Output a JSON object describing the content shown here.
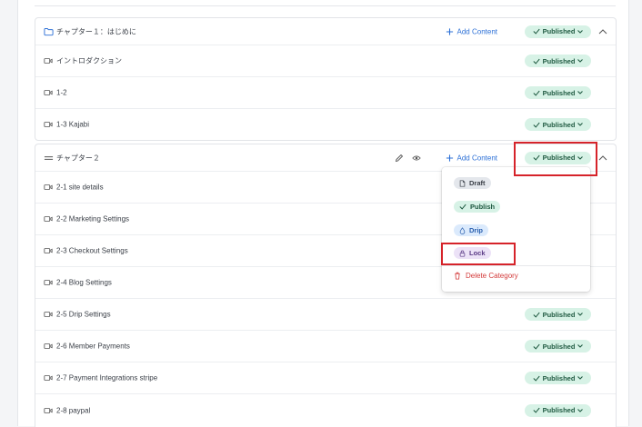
{
  "chapters": [
    {
      "title": "チャプター１：はじめに",
      "add_label": "Add Content",
      "status": "Published",
      "lessons": [
        {
          "title": "イントロダクション",
          "status": "Published"
        },
        {
          "title": "1-2",
          "status": "Published"
        },
        {
          "title": "1-3 Kajabi",
          "status": "Published"
        }
      ]
    },
    {
      "title": "チャプター２",
      "add_label": "Add Content",
      "status": "Published",
      "lessons": [
        {
          "title": "2-1 site details",
          "status": ""
        },
        {
          "title": "2-2 Marketing Settings",
          "status": ""
        },
        {
          "title": "2-3 Checkout Settings",
          "status": ""
        },
        {
          "title": "2-4 Blog Settings",
          "status": ""
        },
        {
          "title": "2-5 Drip Settings",
          "status": "Published"
        },
        {
          "title": "2-6 Member Payments",
          "status": "Published"
        },
        {
          "title": "2-7 Payment Integrations stripe",
          "status": "Published"
        },
        {
          "title": "2-8 paypal",
          "status": "Published"
        }
      ]
    }
  ],
  "status_menu": {
    "options": [
      {
        "label": "Draft",
        "icon": "document-icon"
      },
      {
        "label": "Publish",
        "icon": "check-icon"
      },
      {
        "label": "Drip",
        "icon": "drop-icon"
      },
      {
        "label": "Lock",
        "icon": "lock-icon"
      }
    ],
    "delete_label": "Delete Category"
  },
  "colors": {
    "published_bg": "#d7f2e6",
    "published_text": "#1f5a41",
    "accent_blue": "#2b6fd6",
    "highlight_red": "#d6232a",
    "danger": "#d33a3a"
  }
}
